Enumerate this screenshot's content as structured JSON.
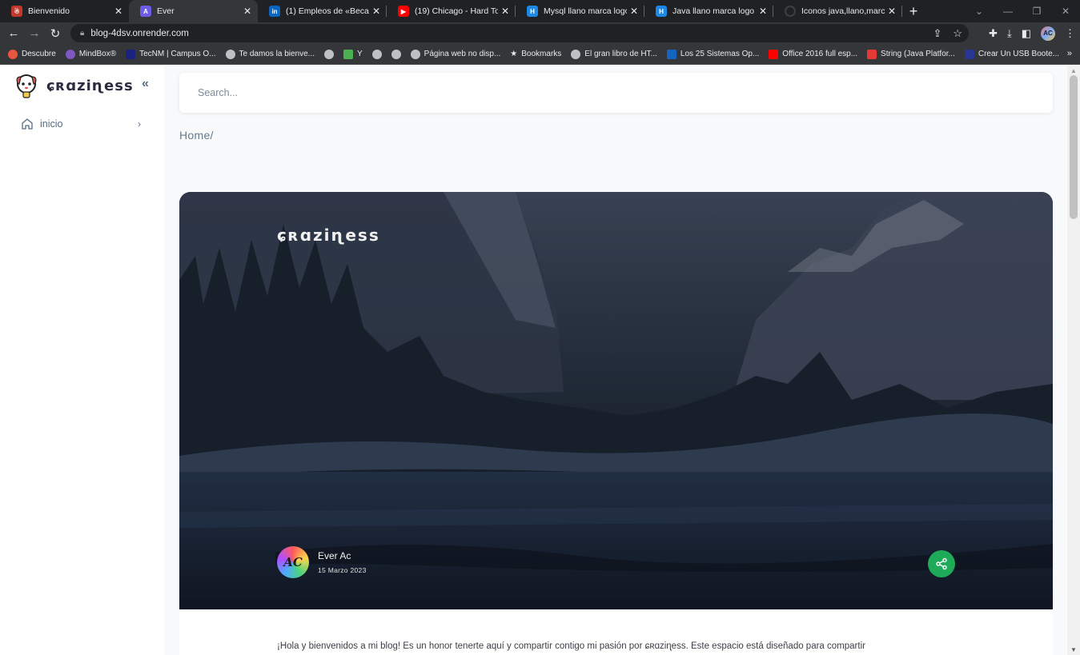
{
  "browser": {
    "tabs": [
      {
        "title": "Bienvenido",
        "favicon_color": "#c0392b",
        "active": false
      },
      {
        "title": "Ever",
        "favicon_color": "#6c5ce7",
        "active": true
      },
      {
        "title": "(1) Empleos de «Becario",
        "favicon_color": "#0a66c2",
        "active": false
      },
      {
        "title": "(19) Chicago - Hard To Sa",
        "favicon_color": "#ff0000",
        "active": false
      },
      {
        "title": "Mysql llano marca logo",
        "favicon_color": "#1e88e5",
        "active": false
      },
      {
        "title": "Java llano marca logo - I",
        "favicon_color": "#1e88e5",
        "active": false
      },
      {
        "title": "Iconos java,llano,marca,l",
        "favicon_color": "#3c4043",
        "active": false
      }
    ],
    "url": "blog-4dsv.onrender.com",
    "profile_initials": "AC",
    "bookmarks": [
      {
        "label": "Descubre",
        "icon_color": "#e8563f"
      },
      {
        "label": "MindBox®",
        "icon_color": "#7e57c2"
      },
      {
        "label": "TecNM | Campus O...",
        "icon_color": "#1a237e"
      },
      {
        "label": "Te damos la bienve...",
        "icon_color": "#bdc1c6"
      },
      {
        "label": "",
        "icon_color": "#bdc1c6"
      },
      {
        "label": "Y",
        "icon_color": "#4caf50"
      },
      {
        "label": "",
        "icon_color": "#bdc1c6"
      },
      {
        "label": "",
        "icon_color": "#bdc1c6"
      },
      {
        "label": "Página web no disp...",
        "icon_color": "#bdc1c6"
      },
      {
        "label": "Bookmarks",
        "icon_color": "#e8eaed"
      },
      {
        "label": "El gran libro de HT...",
        "icon_color": "#bdc1c6"
      },
      {
        "label": "Los 25 Sistemas Op...",
        "icon_color": "#1565c0"
      },
      {
        "label": "Office 2016 full esp...",
        "icon_color": "#ff0000"
      },
      {
        "label": "String (Java Platfor...",
        "icon_color": "#e53935"
      },
      {
        "label": "Crear Un USB Boote...",
        "icon_color": "#283593"
      }
    ]
  },
  "sidebar": {
    "brand": "ɕʀɑziɳess",
    "items": [
      {
        "label": "inicio",
        "icon": "home-icon"
      }
    ]
  },
  "search": {
    "placeholder": "Search..."
  },
  "breadcrumb": "Home/",
  "hero": {
    "title": "ɕʀɑziɳess",
    "author_initials": "AC",
    "author_name": "Ever Ac",
    "date": "15 Marzo 2023"
  },
  "content": {
    "intro": "¡Hola y bienvenidos a mi blog! Es un honor tenerte aquí y compartir contigo mi pasión por ɕʀɑziɳess. Este espacio está diseñado para compartir"
  },
  "colors": {
    "accent_share": "#1faa59",
    "sidebar_text": "#566a7f"
  }
}
